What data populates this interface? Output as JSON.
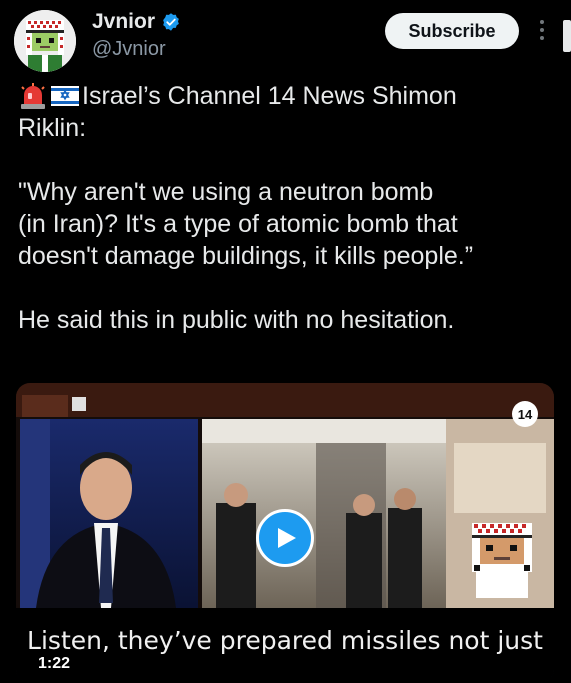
{
  "account": {
    "display_name": "Jvnior",
    "handle": "@Jvnior",
    "verified": true
  },
  "actions": {
    "subscribe_label": "Subscribe"
  },
  "tweet": {
    "line1": "Israel’s Channel 14 News Shimon",
    "line2": "Riklin:",
    "quote_line1": "\"Why aren't we using a neutron bomb",
    "quote_line2": "(in Iran)?  It's a type of atomic bomb that",
    "quote_line3": "doesn't damage buildings, it kills people.”",
    "closing": "He said this in public with no hesitation.",
    "emojis": [
      "police-light-icon",
      "israel-flag-icon"
    ]
  },
  "video": {
    "subtitle": "Listen, they’ve prepared missiles not just",
    "duration": "1:22",
    "channel_number": "14"
  },
  "colors": {
    "background": "#000000",
    "text": "#e7e9ea",
    "secondary_text": "#8b98a5",
    "accent": "#1d9bf0"
  }
}
